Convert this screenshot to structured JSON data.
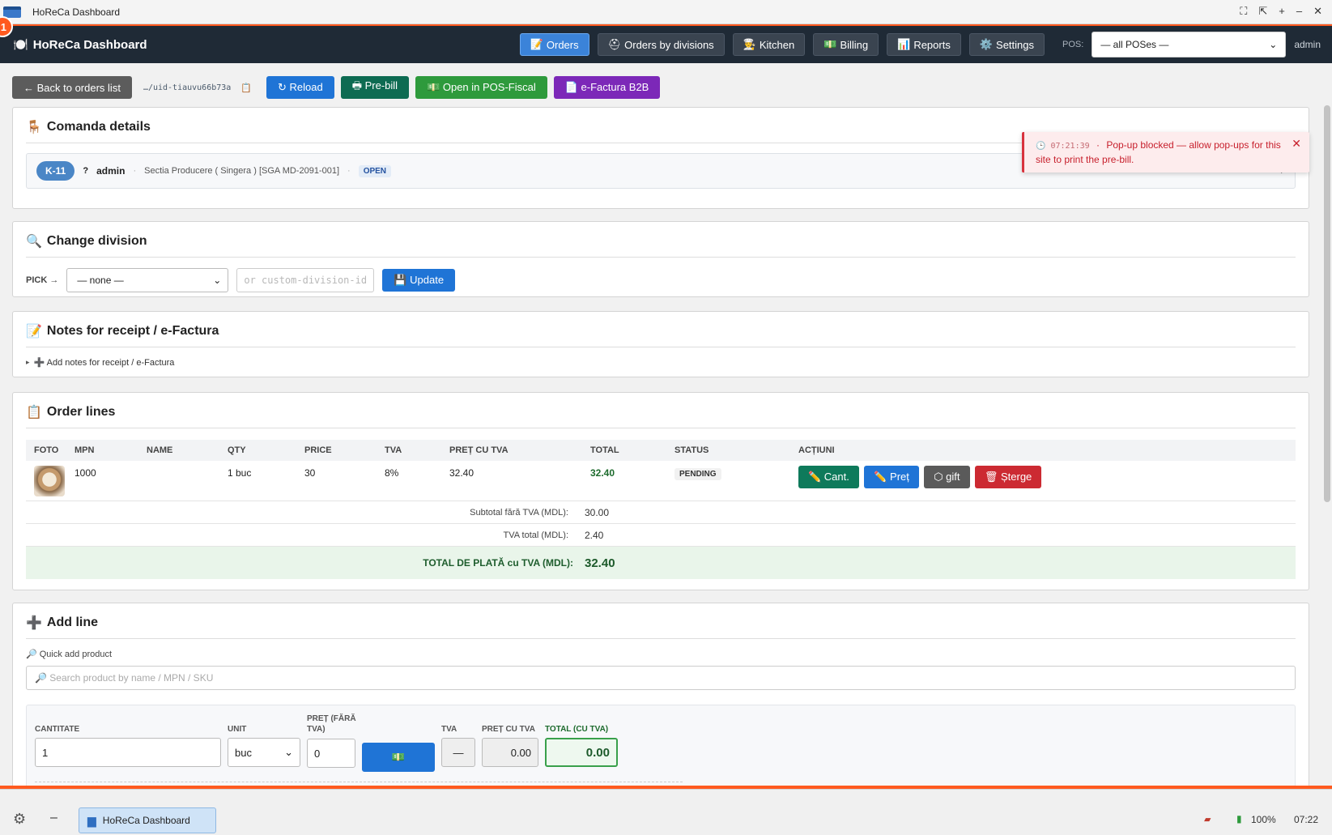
{
  "window": {
    "title": "HoReCa Dashboard",
    "badge": "1",
    "controls": [
      "⛶",
      "⇱",
      "+",
      "–",
      "✕"
    ]
  },
  "navbar": {
    "brand": "HoReCa Dashboard",
    "items": [
      {
        "icon": "📝",
        "label": "Orders",
        "active": true
      },
      {
        "icon": "⛑",
        "label": "Orders by divisions"
      },
      {
        "icon": "👨‍🍳",
        "label": "Kitchen"
      },
      {
        "icon": "💵",
        "label": "Billing"
      },
      {
        "icon": "📊",
        "label": "Reports"
      },
      {
        "icon": "⚙️",
        "label": "Settings"
      }
    ],
    "pos_label": "POS:",
    "pos_value": "— all POSes —",
    "user": "admin"
  },
  "toolbar": {
    "back": "← Back to orders list",
    "uid": "…/uid-tiauvu66b73a",
    "copy_icon": "📋",
    "reload": "↻ Reload",
    "prebill": "🖶 Pre-bill",
    "pos_fiscal": "💵 Open in POS-Fiscal",
    "efactura": "📄 e-Factura B2B"
  },
  "toast": {
    "time": "🕒 07:21:39",
    "sep": "·",
    "message": "Pop-up blocked — allow pop-ups for this site to print the pre-bill.",
    "close": "✕"
  },
  "details": {
    "title": "Comanda details",
    "icon": "🪑",
    "order_id": "K-11",
    "question": "?",
    "user": "admin",
    "sep": "·",
    "division": "Sectia Producere ( Singera ) [SGA MD-2091-001]",
    "status": "OPEN",
    "expand": "▸"
  },
  "division": {
    "title": "Change division",
    "icon": "🔍",
    "pick": "PICK →",
    "select_value": "— none —",
    "custom_placeholder": "or custom-division-id",
    "update": "💾 Update"
  },
  "notes": {
    "title": "Notes for receipt / e-Factura",
    "icon": "📝",
    "toggle": "▸",
    "add": "➕ Add notes for receipt / e-Factura"
  },
  "order_lines": {
    "title": "Order lines",
    "icon": "📋",
    "headers": [
      "FOTO",
      "MPN",
      "NAME",
      "QTY",
      "PRICE",
      "TVA",
      "PREȚ CU TVA",
      "TOTAL",
      "STATUS",
      "ACȚIUNI"
    ],
    "rows": [
      {
        "mpn": "1000",
        "name": "",
        "qty": "1 buc",
        "price": "30",
        "tva": "8%",
        "pret_cu_tva": "32.40",
        "total": "32.40",
        "status": "PENDING"
      }
    ],
    "actions": {
      "cant": "✏️ Cant.",
      "pret": "✏️ Preț",
      "gift": "⬡ gift",
      "sterge": "🗑 Șterge"
    },
    "subtotal_label": "Subtotal fără TVA (MDL):",
    "subtotal_value": "30.00",
    "tva_label": "TVA total (MDL):",
    "tva_value": "2.40",
    "total_label": "TOTAL DE PLATĂ cu TVA (MDL):",
    "total_value": "32.40"
  },
  "add_line": {
    "title": "Add line",
    "icon": "➕",
    "quick_add": "🔎 Quick add product",
    "search_placeholder": "🔎 Search product by name / MPN / SKU",
    "cantitate_label": "CANTITATE",
    "cantitate_value": "1",
    "unit_label": "UNIT",
    "unit_value": "buc",
    "pret_label": "PREȚ (FĂRĂ TVA)",
    "pret_value": "0",
    "money_icon": "💵",
    "tva_label": "TVA",
    "tva_value": "—",
    "pret_cu_tva_label": "PREȚ CU TVA",
    "pret_cu_tva_value": "0.00",
    "total_label": "TOTAL (CU TVA)",
    "total_value": "0.00"
  },
  "taskbar": {
    "app": "HoReCa Dashboard",
    "battery": "100%",
    "time": "07:22"
  },
  "colors": {
    "navbar": "#1f2a36",
    "accent_orange": "#ff5a1f",
    "active_nav": "#3b83d9",
    "total_green": "#1d5a2b"
  }
}
